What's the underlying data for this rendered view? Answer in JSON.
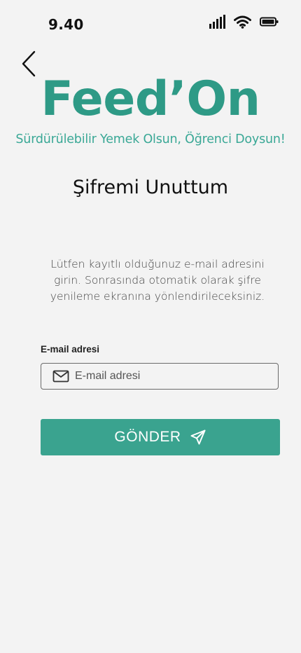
{
  "status_bar": {
    "time": "9.40",
    "icons": [
      "signal-icon",
      "wifi-icon",
      "battery-icon"
    ]
  },
  "nav": {
    "back_icon": "chevron-left-icon"
  },
  "brand": {
    "title": "Feed’On",
    "subtitle": "Sürdürülebilir Yemek Olsun, Öğrenci Doysun!",
    "color": "#2e9a86"
  },
  "page": {
    "title": "Şifremi Unuttum",
    "instruction": "Lütfen kayıtlı olduğunuz e-mail adresini girin. Sonrasında otomatik olarak şifre yenileme ekranına yönlendirileceksiniz."
  },
  "form": {
    "email_label": "E-mail adresi",
    "email_placeholder": "E-mail adresi",
    "email_value": "",
    "email_icon": "mail-icon"
  },
  "submit": {
    "label": "GÖNDER",
    "icon": "send-icon",
    "color": "#3aa38f"
  }
}
